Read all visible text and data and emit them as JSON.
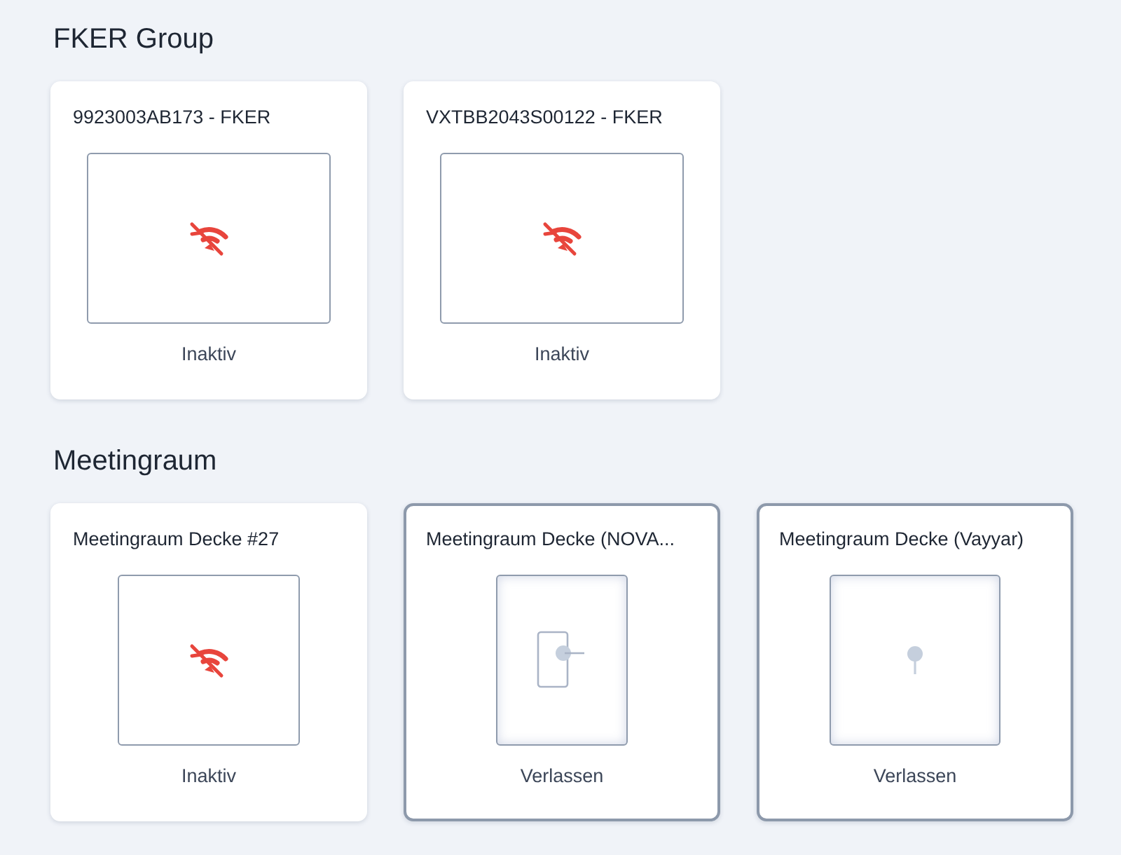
{
  "groups": [
    {
      "title": "FKER Group",
      "devices": [
        {
          "name": "9923003AB173 - FKER",
          "status": "Inaktiv",
          "kind": "offline",
          "room": {
            "kind": "wide"
          }
        },
        {
          "name": "VXTBB2043S00122 - FKER",
          "status": "Inaktiv",
          "kind": "offline",
          "room": {
            "kind": "wide"
          }
        }
      ]
    },
    {
      "title": "Meetingraum",
      "devices": [
        {
          "name": "Meetingraum Decke #27",
          "status": "Inaktiv",
          "kind": "offline",
          "room": {
            "kind": "medium"
          }
        },
        {
          "name": "Meetingraum Decke (NOVA...",
          "status": "Verlassen",
          "kind": "wall-sensor",
          "room": {
            "kind": "tall"
          }
        },
        {
          "name": "Meetingraum Decke (Vayyar)",
          "status": "Verlassen",
          "kind": "ceiling-sensor",
          "room": {
            "kind": "square"
          }
        }
      ]
    }
  ]
}
